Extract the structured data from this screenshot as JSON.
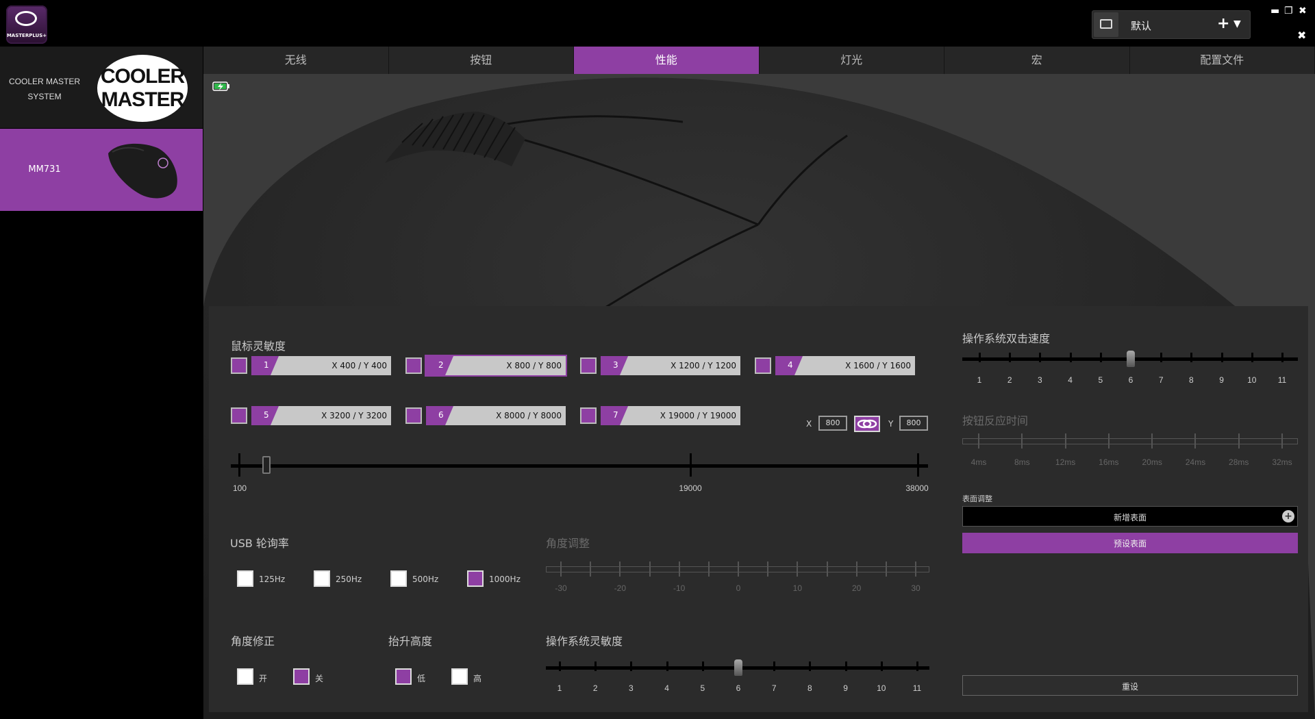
{
  "app": {
    "logo_text": "MASTERPLUS+"
  },
  "profile": {
    "name": "默认"
  },
  "window": {
    "minimize": "▬",
    "restore": "❐",
    "close": "✖",
    "close2": "✖"
  },
  "sidebar": {
    "system_label": "COOLER MASTER SYSTEM",
    "brand_logo_line1": "COOLER",
    "brand_logo_line2": "MASTER",
    "device_label": "MM731"
  },
  "tabs": [
    "无线",
    "按钮",
    "性能",
    "灯光",
    "宏",
    "配置文件"
  ],
  "active_tab": "性能",
  "dpi": {
    "title": "鼠标灵敏度",
    "stages": [
      {
        "num": "1",
        "value": "X 400 / Y 400"
      },
      {
        "num": "2",
        "value": "X 800 / Y 800"
      },
      {
        "num": "3",
        "value": "X 1200 / Y 1200"
      },
      {
        "num": "4",
        "value": "X 1600 / Y 1600"
      },
      {
        "num": "5",
        "value": "X 3200 / Y 3200"
      },
      {
        "num": "6",
        "value": "X 8000 / Y 8000"
      },
      {
        "num": "7",
        "value": "X 19000 / Y 19000"
      }
    ],
    "active_stage": "2",
    "x_label": "X",
    "x_value": "800",
    "y_label": "Y",
    "y_value": "800",
    "slider_labels": [
      "100",
      "19000",
      "38000"
    ],
    "slider_value": 800
  },
  "usb": {
    "title": "USB 轮询率",
    "options": [
      "125Hz",
      "250Hz",
      "500Hz",
      "1000Hz"
    ],
    "selected": "1000Hz"
  },
  "angle_adjust": {
    "title": "角度调整",
    "labels": [
      "-30",
      "-20",
      "-10",
      "0",
      "10",
      "20",
      "30"
    ]
  },
  "angle_snap": {
    "title": "角度修正",
    "on_label": "开",
    "off_label": "关",
    "selected": "关"
  },
  "lift_off": {
    "title": "抬升高度",
    "low_label": "低",
    "high_label": "高",
    "selected": "低"
  },
  "os_sensitivity": {
    "title": "操作系统灵敏度",
    "labels": [
      "1",
      "2",
      "3",
      "4",
      "5",
      "6",
      "7",
      "8",
      "9",
      "10",
      "11"
    ],
    "value": 6
  },
  "double_click": {
    "title": "操作系统双击速度",
    "labels": [
      "1",
      "2",
      "3",
      "4",
      "5",
      "6",
      "7",
      "8",
      "9",
      "10",
      "11"
    ],
    "value": 6
  },
  "response_time": {
    "title": "按钮反应时间",
    "labels": [
      "4ms",
      "8ms",
      "12ms",
      "16ms",
      "20ms",
      "24ms",
      "28ms",
      "32ms"
    ]
  },
  "surface": {
    "title": "表面调整",
    "add_label": "新增表面",
    "preset_label": "预设表面"
  },
  "reset_label": "重设",
  "colors": {
    "accent": "#8e3fa3",
    "background": "#000000",
    "panel": "#2b2b2b"
  }
}
